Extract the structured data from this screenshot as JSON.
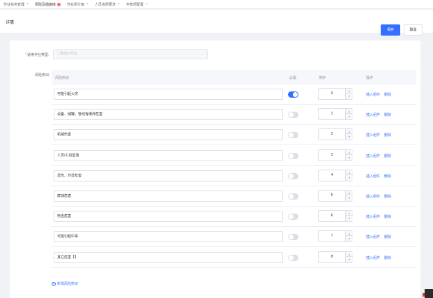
{
  "tabs": [
    {
      "label": "作业任务管理",
      "close": "×",
      "active": false,
      "dot": false
    },
    {
      "label": "风险及措施库",
      "close": "",
      "active": true,
      "dot": true
    },
    {
      "label": "作业票分级",
      "close": "×",
      "active": false,
      "dot": false
    },
    {
      "label": "人员资质要求",
      "close": "×",
      "active": false,
      "dot": false
    },
    {
      "label": "字典项配置",
      "close": "×",
      "active": false,
      "dot": false
    }
  ],
  "header": {
    "title": "详情",
    "save_label": "保存",
    "cancel_label": "取消"
  },
  "form": {
    "type_label_req": "*",
    "type_label": "适用作业类型:",
    "type_placeholder": "二级动火作业",
    "risk_label": "风险辨识:"
  },
  "table": {
    "columns": {
      "name": "风险辨识",
      "required": "必需",
      "order": "排序",
      "ops": "操作"
    },
    "rows": [
      {
        "name": "可能引起火灾",
        "required": true,
        "order": "0"
      },
      {
        "name": "设备、储罐、管线有爆炸危害",
        "required": false,
        "order": "1"
      },
      {
        "name": "机械伤害",
        "required": false,
        "order": "2"
      },
      {
        "name": "人员/工具坠落",
        "required": false,
        "order": "3"
      },
      {
        "name": "烫伤、灼烫危害",
        "required": false,
        "order": "4"
      },
      {
        "name": "腐蚀危害",
        "required": false,
        "order": "5"
      },
      {
        "name": "电击危害",
        "required": false,
        "order": "6"
      },
      {
        "name": "可能引起中毒",
        "required": false,
        "order": "7"
      },
      {
        "name": "其它危害【】",
        "required": false,
        "order": "8"
      }
    ],
    "op_insert": "插入组件",
    "op_delete": "删除"
  },
  "add_link": "新增风险辨识",
  "colors": {
    "accent": "#3370ff",
    "danger": "#f56c6c"
  }
}
